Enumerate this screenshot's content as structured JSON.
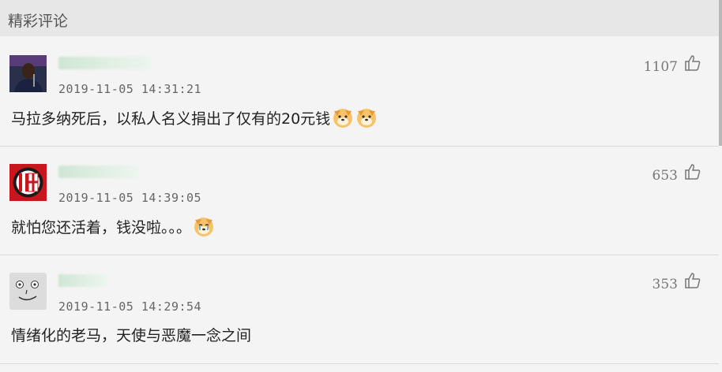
{
  "section": {
    "title": "精彩评论"
  },
  "comments": [
    {
      "timestamp": "2019-11-05 14:31:21",
      "text": "马拉多纳死后，以私人名义捐出了仅有的20元钱",
      "likes": "1107",
      "emoji_count": 2,
      "avatar": "player-photo"
    },
    {
      "timestamp": "2019-11-05 14:39:05",
      "text": "就怕您还活着，钱没啦。。。",
      "likes": "653",
      "emoji_count": 1,
      "avatar": "ac-milan-logo"
    },
    {
      "timestamp": "2019-11-05 14:29:54",
      "text": "情绪化的老马，天使与恶魔一念之间",
      "likes": "353",
      "emoji_count": 0,
      "avatar": "football-face"
    }
  ],
  "colors": {
    "header_bg": "#e7e7e7",
    "page_bg": "#f4f4f4",
    "accent_red": "#c8161d"
  }
}
